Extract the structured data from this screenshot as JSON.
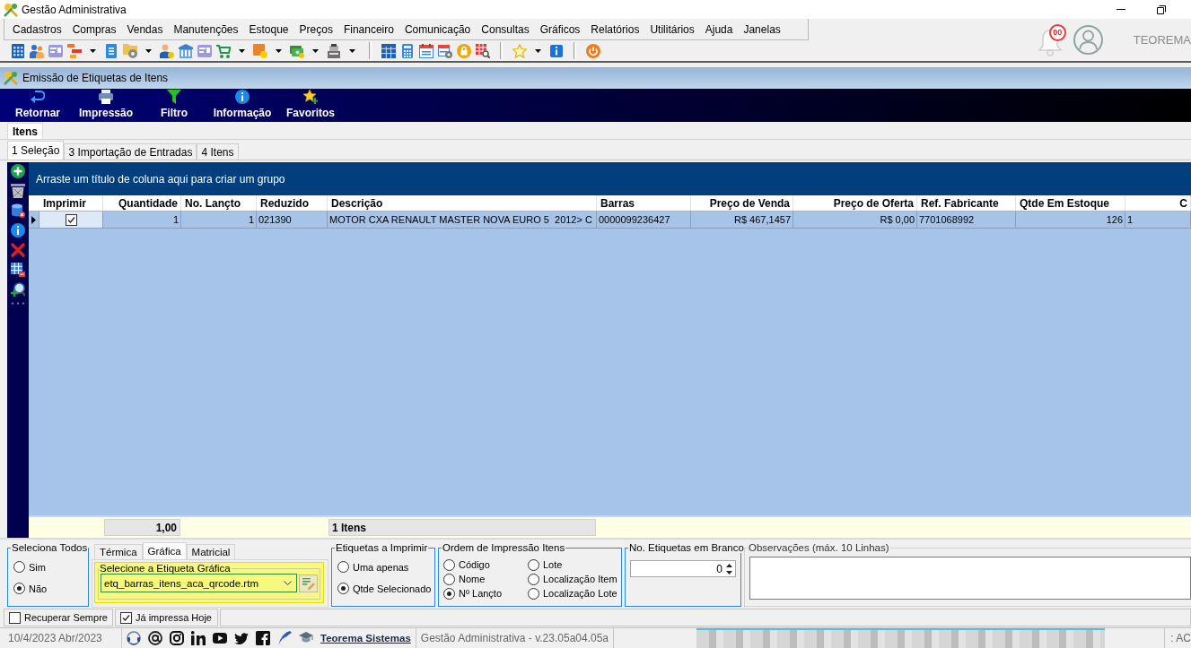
{
  "window": {
    "title": "Gestão Administrativa"
  },
  "menu": [
    "Cadastros",
    "Compras",
    "Vendas",
    "Manutenções",
    "Estoque",
    "Preços",
    "Financeiro",
    "Comunicação",
    "Consultas",
    "Gráficos",
    "Relatórios",
    "Utilitários",
    "Ajuda",
    "Janelas"
  ],
  "notification_badge": "00",
  "user_name": "TEOREMA",
  "form_title": "Emissão de Etiquetas de Itens",
  "actions": [
    "Retornar",
    "Impressão",
    "Filtro",
    "Informação",
    "Favoritos"
  ],
  "page_tabs": [
    {
      "label": "Itens",
      "selected": true
    }
  ],
  "subtabs": [
    {
      "label": "1 Seleção",
      "selected": true
    },
    {
      "label": "3 Importação de Entradas",
      "selected": false
    },
    {
      "label": "4 Itens",
      "selected": false
    }
  ],
  "grid": {
    "group_hint": "Arraste um título de coluna aqui para criar um grupo",
    "check_column": "Imprimir",
    "columns": [
      "Quantidade",
      "No. Lançto",
      "Reduzido",
      "Descrição",
      "Barras",
      "Preço de Venda",
      "Preço de Oferta",
      "Ref. Fabricante",
      "Qtde Em Estoque",
      "C"
    ],
    "rows": [
      {
        "selected": true,
        "checked": true,
        "cells": [
          "1",
          "1",
          "021390",
          "MOTOR CXA RENAULT MASTER NOVA EURO 5  2012> C",
          "0000099236427",
          "R$ 467,1457",
          "R$ 0,00",
          "7701068992",
          "126",
          "1"
        ]
      }
    ],
    "footer": {
      "quantity_total": "1,00",
      "summary": "1 Itens"
    }
  },
  "select_all": {
    "title": "Seleciona Todos",
    "options": [
      {
        "label": "Sim",
        "selected": false
      },
      {
        "label": "Não",
        "selected": true
      }
    ]
  },
  "label_type_tabs": [
    {
      "label": "Térmica",
      "selected": false
    },
    {
      "label": "Gráfica",
      "selected": true
    },
    {
      "label": "Matricial",
      "selected": false
    }
  ],
  "graphic_label": {
    "title": "Selecione a Etiqueta Gráfica",
    "value": "etq_barras_itens_aca_qrcode.rtm"
  },
  "labels_to_print": {
    "title": "Etiquetas a Imprimir",
    "options": [
      {
        "label": "Uma apenas",
        "selected": false
      },
      {
        "label": "Qtde Selecionado",
        "selected": true
      }
    ]
  },
  "print_order": {
    "title": "Ordem de Impressão Itens",
    "options": [
      {
        "label": "Código",
        "selected": false
      },
      {
        "label": "Nome",
        "selected": false
      },
      {
        "label": "Nº Lançto",
        "selected": true
      },
      {
        "label": "Lote",
        "selected": false
      },
      {
        "label": "Localização Item",
        "selected": false
      },
      {
        "label": "Localização Lote",
        "selected": false
      }
    ]
  },
  "blank_labels": {
    "title": "No. Etiquetas em Branco",
    "value": "0"
  },
  "notes": {
    "title": "Observações (máx. 10 Linhas)"
  },
  "options": [
    {
      "label": "Recuperar Sempre",
      "checked": false
    },
    {
      "label": "Já impressa Hoje",
      "checked": true
    }
  ],
  "status_bar": {
    "date": "10/4/2023 Abr/2023",
    "link": "Teorema Sistemas",
    "version": "Gestão Administrativa - v.23.05a04.05a",
    "panel_text": ": AC"
  }
}
